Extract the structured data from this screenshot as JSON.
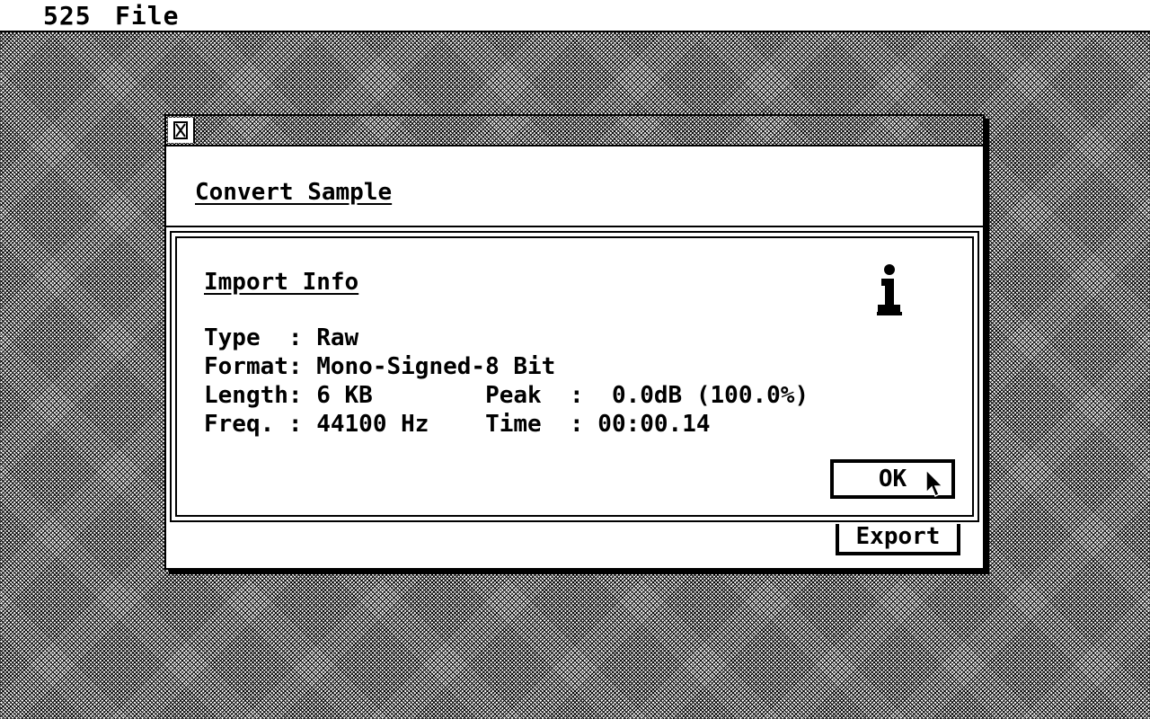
{
  "menubar": {
    "app_label": "525",
    "file_label": "File"
  },
  "window": {
    "heading": "Convert Sample",
    "close_icon": "close-box-icon",
    "export_label": "Export"
  },
  "alert": {
    "title": "Import Info",
    "icon": "info-icon",
    "rows": [
      "Type  : Raw",
      "Format: Mono-Signed-8 Bit",
      "Length: 6 KB        Peak  :  0.0dB (100.0%)",
      "Freq. : 44100 Hz    Time  : 00:00.14"
    ],
    "ok_label": "OK"
  },
  "colors": {
    "foreground": "#000000",
    "background": "#ffffff"
  }
}
